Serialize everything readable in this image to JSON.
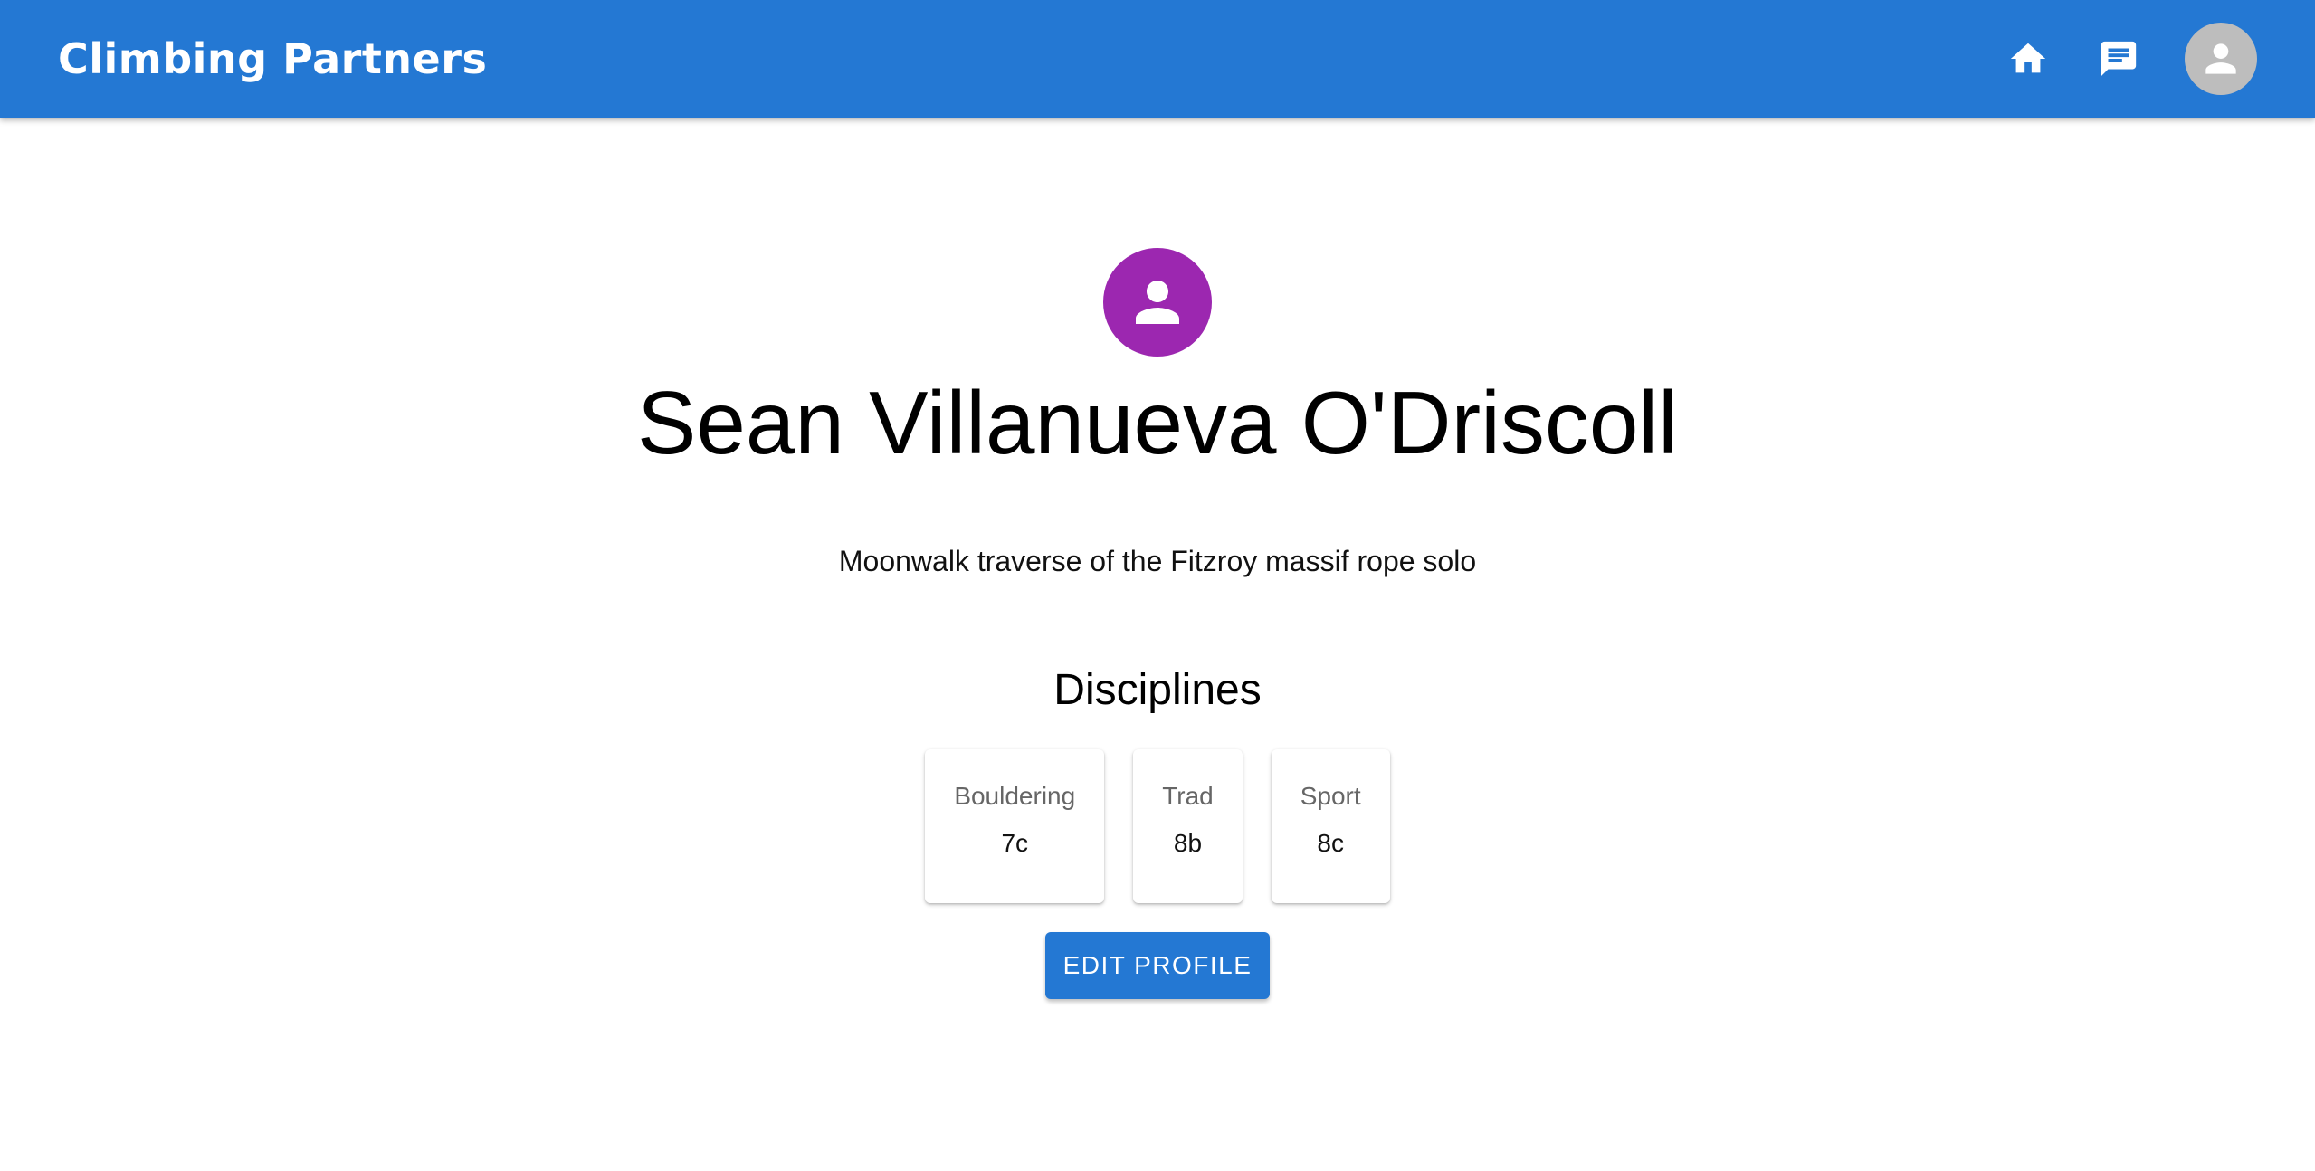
{
  "app": {
    "title": "Climbing Partners",
    "brand_color": "#2478d3"
  },
  "header": {
    "actions": [
      {
        "icon": "home-icon"
      },
      {
        "icon": "message-icon"
      },
      {
        "icon": "account-avatar-icon"
      }
    ]
  },
  "profile": {
    "avatar_color": "#9c27b0",
    "name": "Sean Villanueva O'Driscoll",
    "bio": "Moonwalk traverse of the Fitzroy massif rope solo",
    "disciplines_heading": "Disciplines",
    "disciplines": [
      {
        "name": "Bouldering",
        "grade": "7c"
      },
      {
        "name": "Trad",
        "grade": "8b"
      },
      {
        "name": "Sport",
        "grade": "8c"
      }
    ],
    "edit_button_label": "Edit Profile"
  }
}
